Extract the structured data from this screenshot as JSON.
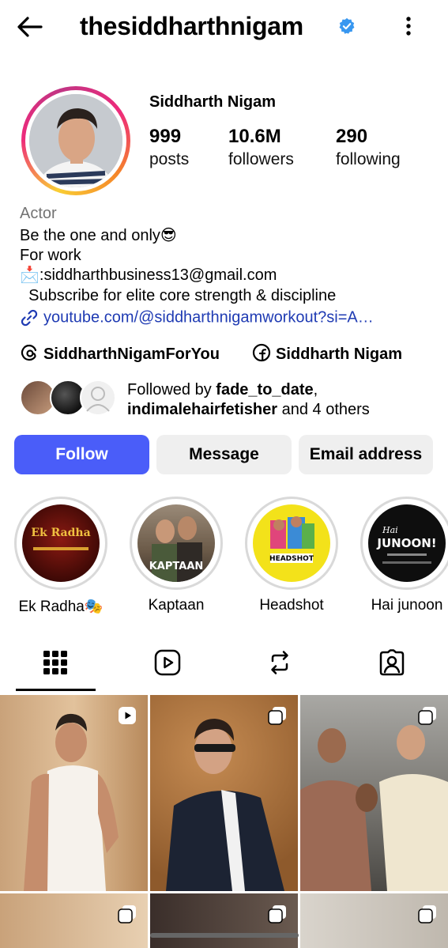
{
  "header": {
    "username": "thesiddharthnigam",
    "back_icon": "back-arrow-icon",
    "verified_icon": "verified-badge-icon",
    "more_icon": "more-vertical-icon",
    "verified_color": "#3897f0"
  },
  "profile": {
    "full_name": "Siddharth Nigam",
    "stats": [
      {
        "value": "999",
        "label": "posts"
      },
      {
        "value": "10.6M",
        "label": "followers"
      },
      {
        "value": "290",
        "label": "following"
      }
    ]
  },
  "bio": {
    "category": "Actor",
    "lines": [
      "Be the one and only😎",
      "For work",
      "📩:siddharthbusiness13@gmail.com",
      "  Subscribe for elite core strength & discipline"
    ],
    "link": "youtube.com/@siddharthnigamworkout?si=A…",
    "link_icon": "link-icon"
  },
  "social_links": [
    {
      "icon": "threads-icon",
      "label": "SiddharthNigamForYou"
    },
    {
      "icon": "facebook-icon",
      "label": "Siddharth Nigam"
    }
  ],
  "followed_by": {
    "prefix": "Followed by ",
    "user1": "fade_to_date",
    "sep": ",",
    "user2": "indimalehairfetisher",
    "suffix": " and 4 others"
  },
  "actions": {
    "follow": "Follow",
    "message": "Message",
    "email": "Email address",
    "accent": "#4a5df9"
  },
  "highlights": [
    {
      "label": "Ek Radha🎭",
      "image_text": "Ek Radha"
    },
    {
      "label": "Kaptaan",
      "image_text": "KAPTAAN"
    },
    {
      "label": "Headshot",
      "image_text": "HEADSHOT"
    },
    {
      "label": "Hai junoon",
      "image_text": "JUNOON!",
      "image_subtext": "Hai"
    }
  ],
  "tabs": [
    {
      "icon": "grid-icon",
      "active": true
    },
    {
      "icon": "reels-icon",
      "active": false
    },
    {
      "icon": "reposts-icon",
      "active": false
    },
    {
      "icon": "tagged-icon",
      "active": false
    }
  ]
}
